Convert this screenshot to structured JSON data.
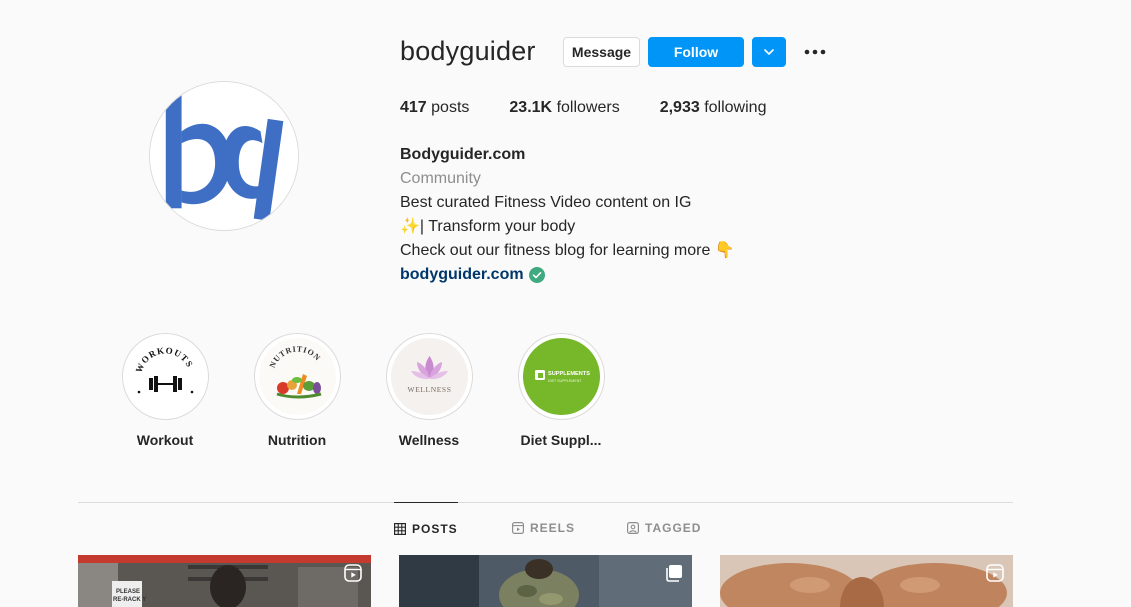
{
  "profile": {
    "username": "bodyguider",
    "message_label": "Message",
    "follow_label": "Follow"
  },
  "stats": {
    "posts_count": "417",
    "posts_label": "posts",
    "followers_count": "23.1K",
    "followers_label": "followers",
    "following_count": "2,933",
    "following_label": "following"
  },
  "bio": {
    "name": "Bodyguider.com",
    "category": "Community",
    "line1": "Best curated Fitness Video content on IG",
    "line2": "✨| Transform your body",
    "line3": "Check out our fitness blog for learning more 👇",
    "link": "bodyguider.com"
  },
  "highlights": [
    {
      "label": "Workout",
      "art_text": "WORKOUTS"
    },
    {
      "label": "Nutrition",
      "art_text": "NUTRITION"
    },
    {
      "label": "Wellness",
      "art_text": "WELLNESS"
    },
    {
      "label": "Diet Suppl...",
      "art_text": "SUPPLEMENTS",
      "art_subtext": "DIET SUPPLEMENT"
    }
  ],
  "tabs": [
    {
      "label": "POSTS",
      "icon": "grid-icon",
      "active": true
    },
    {
      "label": "REELS",
      "icon": "reels-icon",
      "active": false
    },
    {
      "label": "TAGGED",
      "icon": "tagged-icon",
      "active": false
    }
  ],
  "posts": [
    {
      "type": "reel",
      "badge_icon": "reel-icon",
      "sign_line1": "PLEASE",
      "sign_line2": "RE-RACK Y"
    },
    {
      "type": "carousel",
      "badge_icon": "carousel-icon"
    },
    {
      "type": "reel",
      "badge_icon": "reel-icon"
    }
  ],
  "colors": {
    "accent": "#0095f6",
    "link": "#00376b",
    "brand_logo": "#3f6fc4",
    "verified": "#3fa97f",
    "supplement_green": "#76b82a"
  }
}
